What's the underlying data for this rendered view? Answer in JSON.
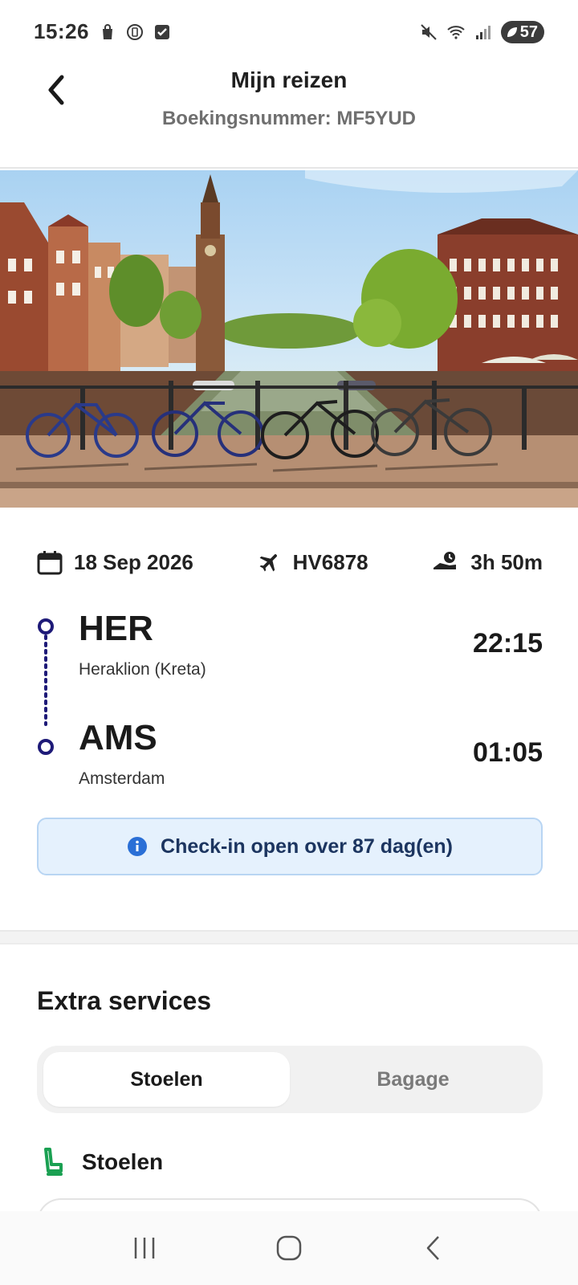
{
  "status_bar": {
    "time": "15:26",
    "battery": "57",
    "left_icons": [
      "shopping-bag-icon",
      "media-icon",
      "checkbox-icon"
    ],
    "right_icons": [
      "mute-icon",
      "wifi-icon",
      "signal-icon",
      "battery-icon"
    ]
  },
  "header": {
    "title": "Mijn reizen",
    "subtitle": "Boekingsnummer: MF5YUD"
  },
  "flight": {
    "date": "18 Sep 2026",
    "flight_number": "HV6878",
    "duration": "3h 50m",
    "departure": {
      "code": "HER",
      "city": "Heraklion (Kreta)",
      "time": "22:15"
    },
    "arrival": {
      "code": "AMS",
      "city": "Amsterdam",
      "time": "01:05"
    },
    "checkin_notice": "Check-in open over 87 dag(en)"
  },
  "extras": {
    "title": "Extra services",
    "tabs": [
      "Stoelen",
      "Bagage"
    ],
    "active_tab": "Stoelen",
    "section_label": "Stoelen"
  },
  "colors": {
    "route_accent": "#1e1a78",
    "info_blue": "#2a6fd6",
    "seat_green": "#1aa052"
  }
}
